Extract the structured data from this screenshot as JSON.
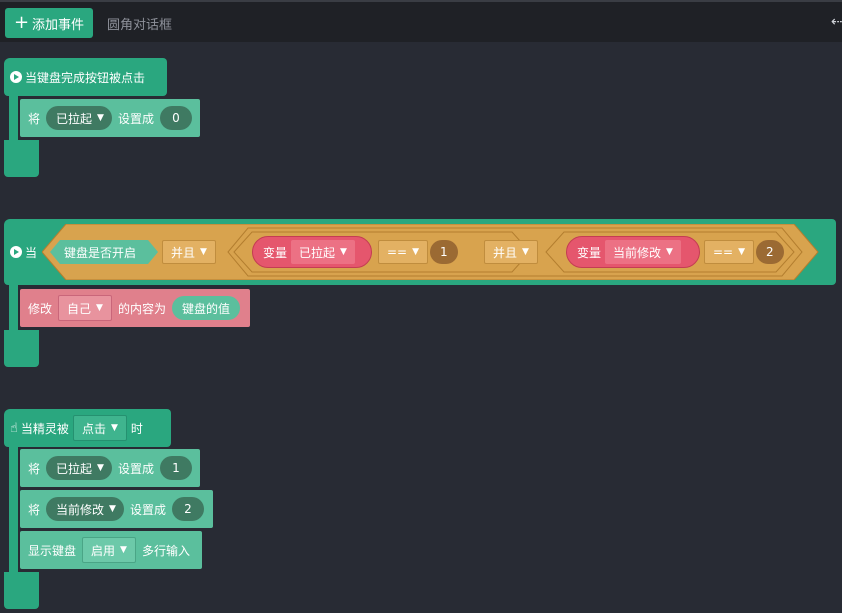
{
  "toolbar": {
    "add_event_label": "添加事件",
    "tab_label": "圆角对话框"
  },
  "event1": {
    "hat": "当键盘完成按钮被点击",
    "stmt": {
      "prefix": "将",
      "var": "已拉起",
      "action": "设置成",
      "value": "0"
    }
  },
  "event2": {
    "hat_prefix": "当",
    "cond_bool": "键盘是否开启",
    "and1": "并且",
    "var_prefix1": "变量",
    "var_name1": "已拉起",
    "op1": "==",
    "val1": "1",
    "and2": "并且",
    "var_prefix2": "变量",
    "var_name2": "当前修改",
    "op2": "==",
    "val2": "2",
    "stmt": {
      "prefix": "修改",
      "target": "自己",
      "middle": "的内容为",
      "value": "键盘的值"
    }
  },
  "event3": {
    "hat_prefix": "当精灵被",
    "trigger": "点击",
    "hat_suffix": "时",
    "stmt1": {
      "prefix": "将",
      "var": "已拉起",
      "action": "设置成",
      "value": "1"
    },
    "stmt2": {
      "prefix": "将",
      "var": "当前修改",
      "action": "设置成",
      "value": "2"
    },
    "stmt3": {
      "prefix": "显示键盘",
      "mode": "启用",
      "suffix": "多行输入"
    }
  },
  "colors": {
    "background": "#282b34",
    "event_green": "#2aa77f",
    "statement_green": "#5bbf9d",
    "variable_pill": "#3f7a62",
    "condition_orange": "#d8a34e",
    "variable_red": "#e5566d",
    "number_brown": "#9b6a33",
    "modify_pink": "#e0808c"
  },
  "icons": [
    "plus-icon",
    "play-circle-icon",
    "hand-pointer-icon",
    "caret-down-icon",
    "exit-icon"
  ]
}
